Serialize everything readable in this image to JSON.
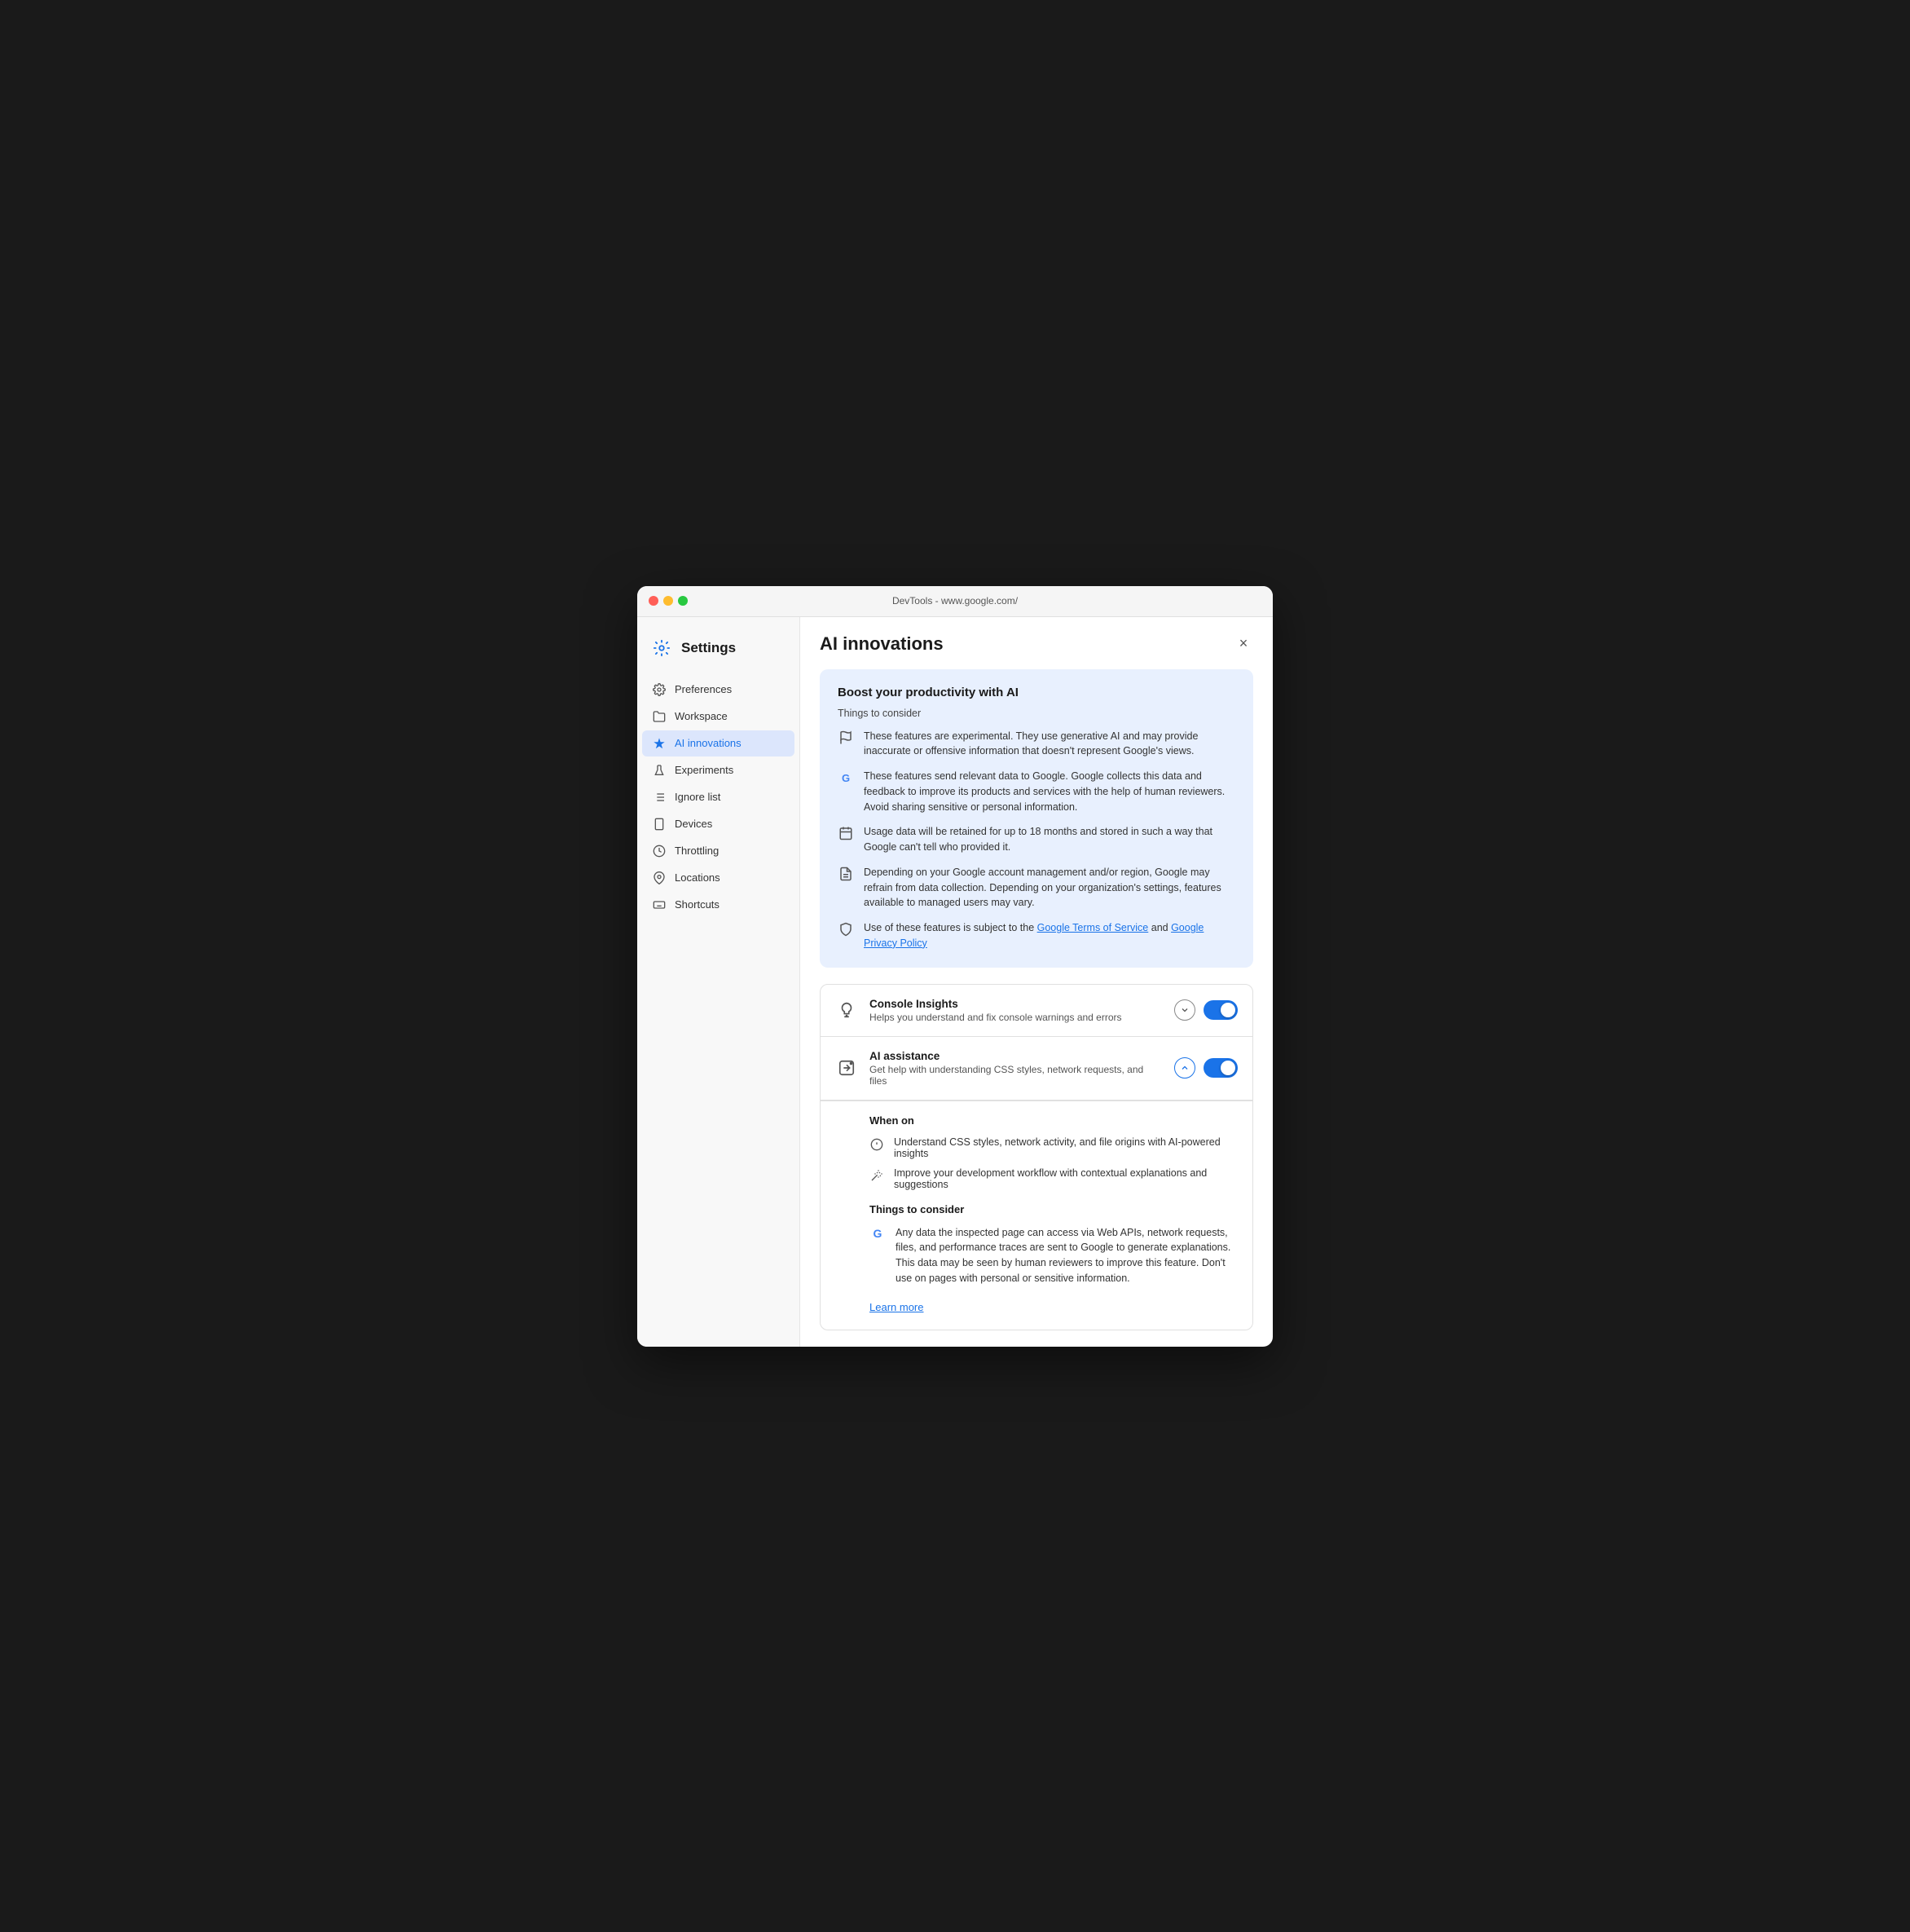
{
  "window": {
    "title": "DevTools - www.google.com/"
  },
  "sidebar": {
    "header_title": "Settings",
    "items": [
      {
        "id": "preferences",
        "label": "Preferences",
        "icon": "gear-icon"
      },
      {
        "id": "workspace",
        "label": "Workspace",
        "icon": "folder-icon"
      },
      {
        "id": "ai-innovations",
        "label": "AI innovations",
        "icon": "sparkle-icon",
        "active": true
      },
      {
        "id": "experiments",
        "label": "Experiments",
        "icon": "flask-icon"
      },
      {
        "id": "ignore-list",
        "label": "Ignore list",
        "icon": "list-icon"
      },
      {
        "id": "devices",
        "label": "Devices",
        "icon": "device-icon"
      },
      {
        "id": "throttling",
        "label": "Throttling",
        "icon": "throttle-icon"
      },
      {
        "id": "locations",
        "label": "Locations",
        "icon": "location-icon"
      },
      {
        "id": "shortcuts",
        "label": "Shortcuts",
        "icon": "keyboard-icon"
      }
    ]
  },
  "main": {
    "title": "AI innovations",
    "close_label": "×",
    "info_card": {
      "title": "Boost your productivity with AI",
      "consider_label": "Things to consider",
      "items": [
        {
          "icon": "experimental-icon",
          "text": "These features are experimental. They use generative AI and may provide inaccurate or offensive information that doesn't represent Google's views."
        },
        {
          "icon": "google-icon",
          "text": "These features send relevant data to Google. Google collects this data and feedback to improve its products and services with the help of human reviewers. Avoid sharing sensitive or personal information."
        },
        {
          "icon": "calendar-icon",
          "text": "Usage data will be retained for up to 18 months and stored in such a way that Google can't tell who provided it."
        },
        {
          "icon": "document-icon",
          "text": "Depending on your Google account management and/or region, Google may refrain from data collection. Depending on your organization's settings, features available to managed users may vary."
        },
        {
          "icon": "shield-icon",
          "text_before": "Use of these features is subject to the ",
          "link1_text": "Google Terms of Service",
          "text_middle": " and ",
          "link2_text": "Google Privacy Policy",
          "text_after": "",
          "has_links": true
        }
      ]
    },
    "features": [
      {
        "id": "console-insights",
        "icon": "lightbulb-icon",
        "name": "Console Insights",
        "desc": "Helps you understand and fix console warnings and errors",
        "expanded": false,
        "toggle": true
      },
      {
        "id": "ai-assistance",
        "icon": "ai-assist-icon",
        "name": "AI assistance",
        "desc": "Get help with understanding CSS styles, network requests, and files",
        "expanded": true,
        "toggle": true,
        "when_on_label": "When on",
        "when_on_items": [
          {
            "icon": "info-icon",
            "text": "Understand CSS styles, network activity, and file origins with AI-powered insights"
          },
          {
            "icon": "wand-icon",
            "text": "Improve your development workflow with contextual explanations and suggestions"
          }
        ],
        "things_label": "Things to consider",
        "things_items": [
          {
            "icon": "google-icon",
            "text": "Any data the inspected page can access via Web APIs, network requests, files, and performance traces are sent to Google to generate explanations. This data may be seen by human reviewers to improve this feature. Don't use on pages with personal or sensitive information."
          }
        ],
        "learn_more_text": "Learn more"
      }
    ]
  },
  "colors": {
    "accent": "#1a73e8",
    "active_bg": "#dce6fc",
    "info_card_bg": "#e8f0fe"
  }
}
